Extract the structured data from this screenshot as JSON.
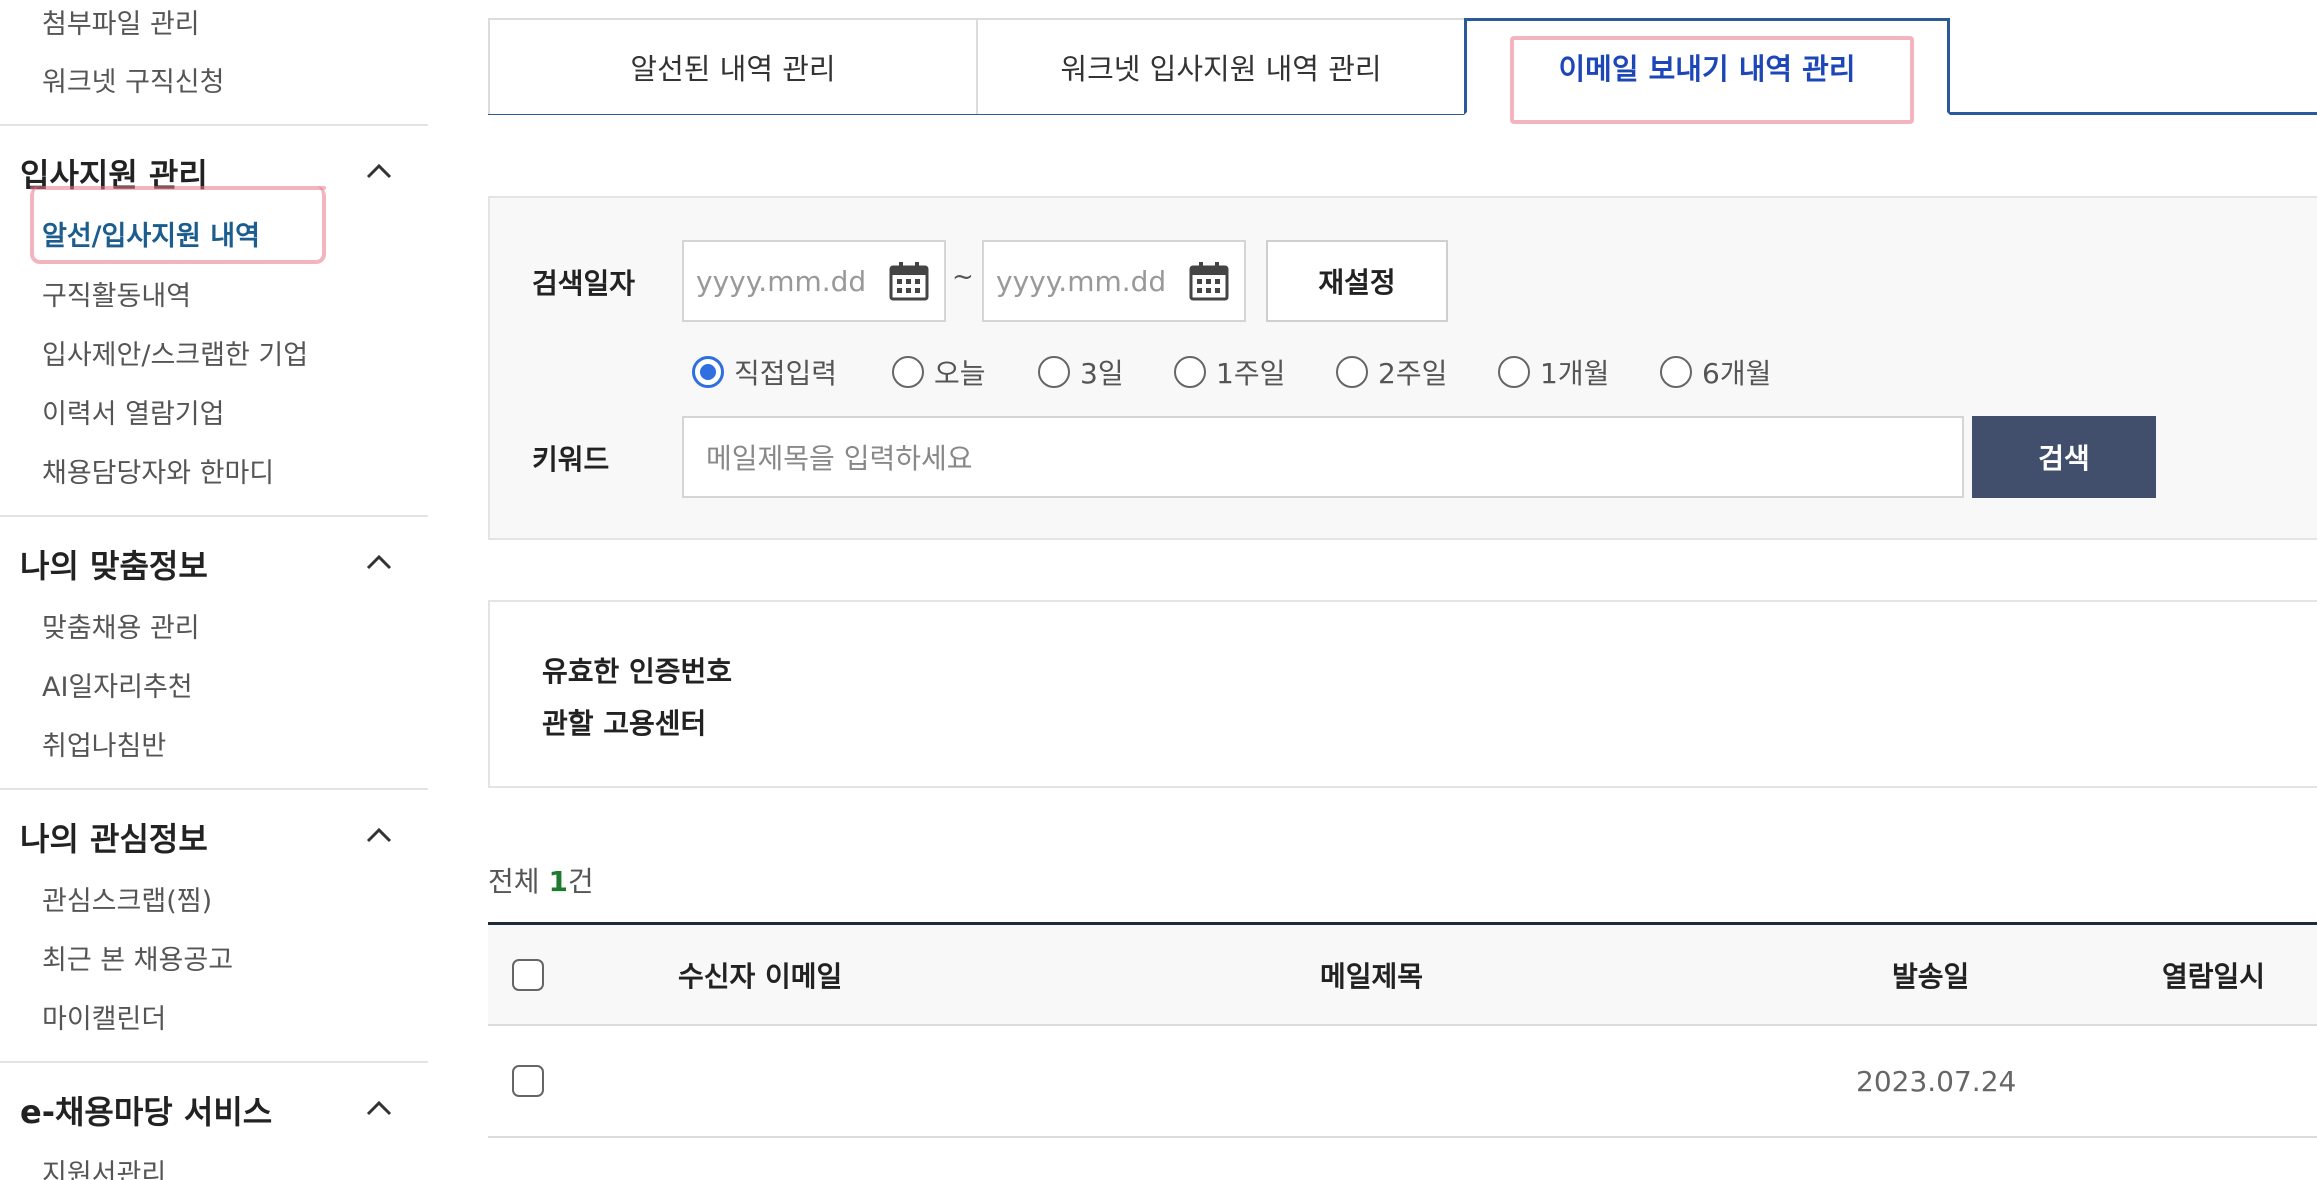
{
  "sidebar": {
    "top_items": [
      "첨부파일 관리",
      "워크넷 구직신청"
    ],
    "sections": [
      {
        "title": "입사지원 관리",
        "items": [
          "알선/입사지원 내역",
          "구직활동내역",
          "입사제안/스크랩한 기업",
          "이력서 열람기업",
          "채용담당자와 한마디"
        ]
      },
      {
        "title": "나의 맞춤정보",
        "items": [
          "맞춤채용 관리",
          "AI일자리추천",
          "취업나침반"
        ]
      },
      {
        "title": "나의 관심정보",
        "items": [
          "관심스크랩(찜)",
          "최근 본 채용공고",
          "마이캘린더"
        ]
      },
      {
        "title": "e-채용마당 서비스",
        "items": [
          "지원서관리"
        ]
      }
    ],
    "active_item": "알선/입사지원 내역"
  },
  "tabs": [
    {
      "label": "알선된 내역 관리",
      "active": false
    },
    {
      "label": "워크넷 입사지원 내역 관리",
      "active": false
    },
    {
      "label": "이메일 보내기 내역 관리",
      "active": true
    }
  ],
  "search": {
    "date_label": "검색일자",
    "start_date_placeholder": "yyyy.mm.dd",
    "end_date_placeholder": "yyyy.mm.dd",
    "range_separator": "~",
    "reset_label": "재설정",
    "period_options": [
      "직접입력",
      "오늘",
      "3일",
      "1주일",
      "2주일",
      "1개월",
      "6개월"
    ],
    "selected_period": "직접입력",
    "keyword_label": "키워드",
    "keyword_placeholder": "메일제목을 입력하세요",
    "search_label": "검색"
  },
  "info": {
    "cert_label": "유효한 인증번호",
    "center_label": "관할 고용센터"
  },
  "results": {
    "total_prefix": "전체",
    "total_count": "1",
    "total_suffix": "건"
  },
  "table": {
    "columns": [
      "수신자 이메일",
      "메일제목",
      "발송일",
      "열람일시"
    ],
    "rows": [
      {
        "recipient": "",
        "subject": "",
        "sent_date": "2023.07.24",
        "opened": ""
      }
    ]
  },
  "colors": {
    "accent_blue": "#2a5a97",
    "active_tab_text": "#1d46b8",
    "search_button": "#424f6c",
    "radio_selected": "#2f6fe0",
    "highlight_marker": "#e8788c"
  }
}
